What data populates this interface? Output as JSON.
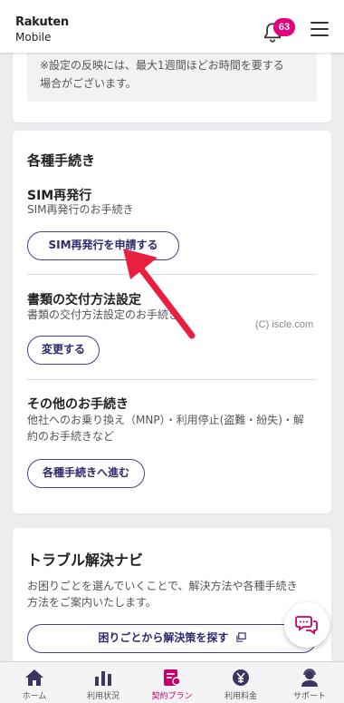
{
  "header": {
    "logo_line1": "Rakuten",
    "logo_line2": "Mobile",
    "notification_count": "63"
  },
  "notice": {
    "line1": "※設定の反映には、最大1週間ほどお時間を要する",
    "line2": "場合がございます。"
  },
  "procedures": {
    "title": "各種手続き",
    "sections": [
      {
        "title": "SIM再発行",
        "desc": "SIM再発行のお手続き",
        "button": "SIM再発行を申請する"
      },
      {
        "title": "書類の交付方法設定",
        "desc": "書類の交付方法設定のお手続き",
        "button": "変更する"
      },
      {
        "title": "その他のお手続き",
        "desc_line1": "他社へのお乗り換え（MNP）・利用停止(盗難・紛失)・解",
        "desc_line2": "約のお手続きなど",
        "button": "各種手続きへ進む"
      }
    ]
  },
  "watermark": "(C) iscle.com",
  "trouble": {
    "title": "トラブル解決ナビ",
    "desc_line1": "お困りごとを選んでいくことで、解決方法や各種手続き",
    "desc_line2": "方法をご案内いたします。",
    "button": "困りごとから解決策を探す"
  },
  "nav": {
    "items": [
      {
        "label": "ホーム",
        "icon": "home-icon"
      },
      {
        "label": "利用状況",
        "icon": "bar-chart-icon"
      },
      {
        "label": "契約プラン",
        "icon": "contract-plan-icon"
      },
      {
        "label": "利用料金",
        "icon": "yen-coin-icon"
      },
      {
        "label": "サポート",
        "icon": "support-icon"
      }
    ],
    "active_index": 2
  },
  "colors": {
    "accent": "#e3007f",
    "button_border": "#4b3f8f",
    "arrow": "#e8203f"
  }
}
